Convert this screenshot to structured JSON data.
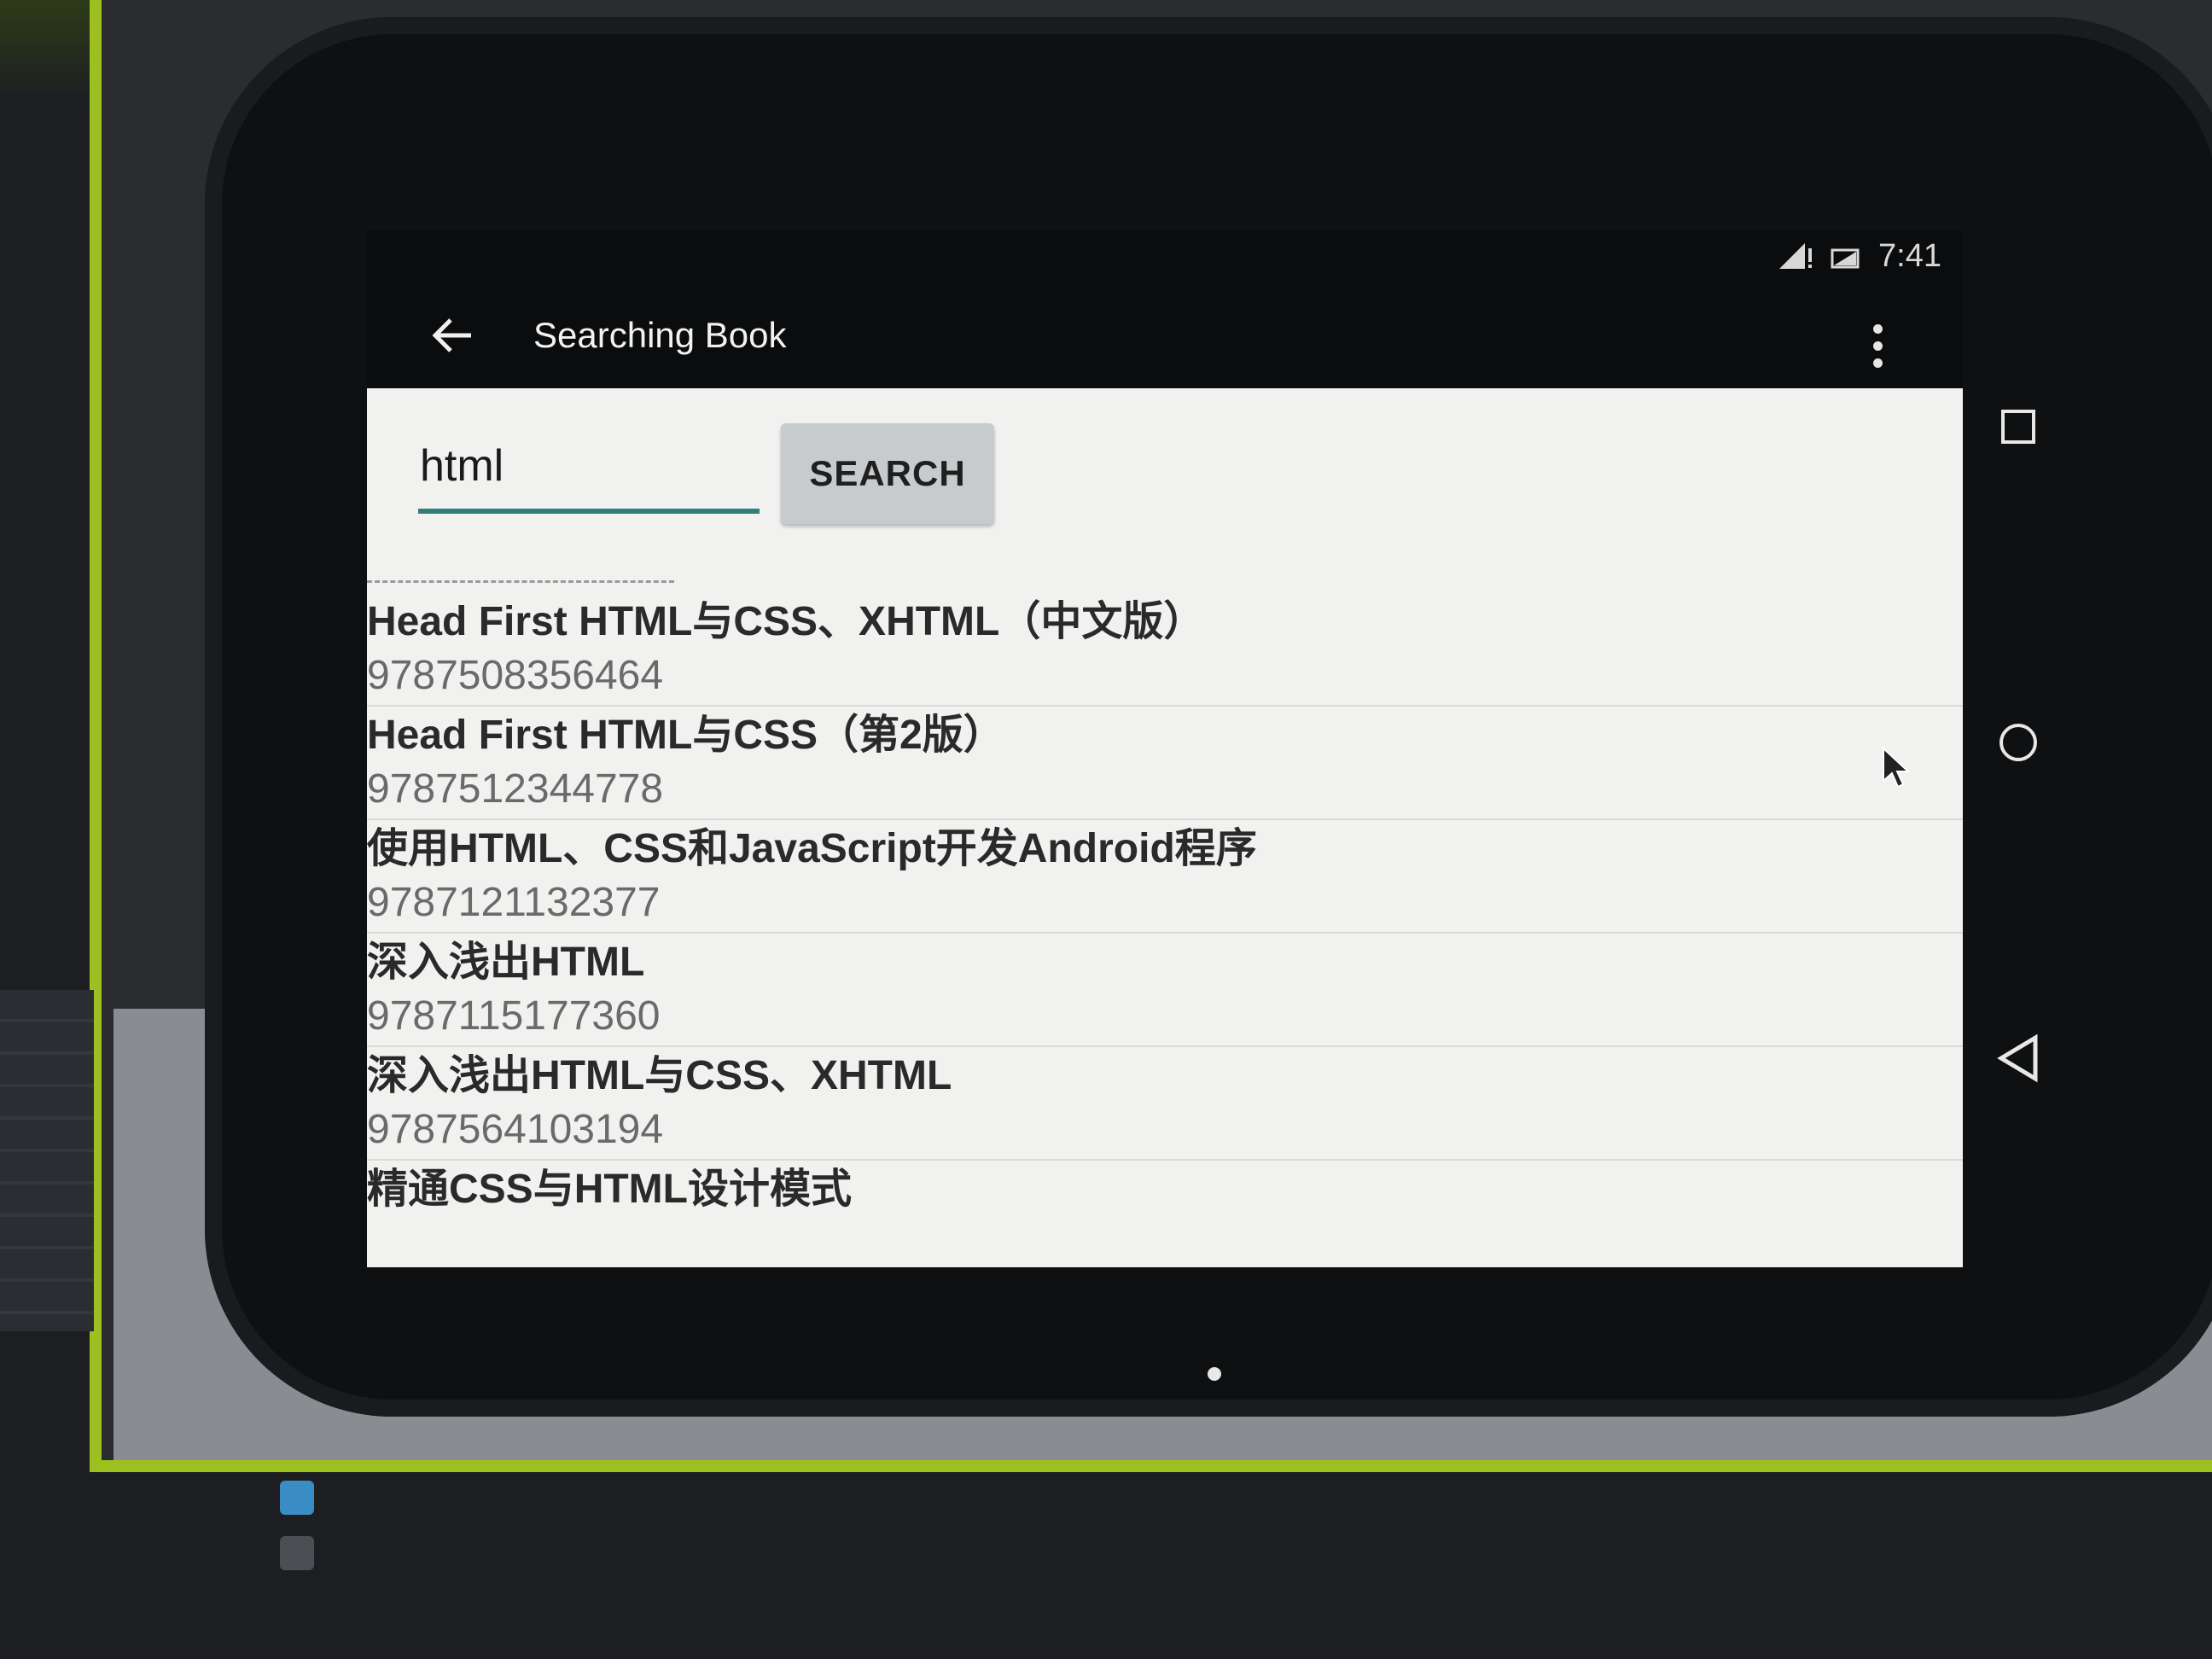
{
  "status_bar": {
    "time": "7:41"
  },
  "toolbar": {
    "title": "Searching Book"
  },
  "search": {
    "query": "html",
    "button_label": "SEARCH"
  },
  "books": [
    {
      "title": "Head First HTML与CSS、XHTML（中文版）",
      "isbn": "9787508356464"
    },
    {
      "title": "Head First HTML与CSS（第2版）",
      "isbn": "9787512344778"
    },
    {
      "title": "使用HTML、CSS和JavaScript开发Android程序",
      "isbn": "9787121132377"
    },
    {
      "title": "深入浅出HTML",
      "isbn": "9787115177360"
    },
    {
      "title": "深入浅出HTML与CSS、XHTML",
      "isbn": "9787564103194"
    },
    {
      "title": "精通CSS与HTML设计模式",
      "isbn": ""
    }
  ],
  "icons": {
    "back": "arrow-back-icon",
    "overflow": "more-vert-icon",
    "recents": "square-icon",
    "home": "circle-icon",
    "nav_back": "triangle-back-icon",
    "signal": "signal-icon",
    "battery": "battery-icon"
  },
  "colors": {
    "accent_underline": "#2f7f7a",
    "frame": "#9cc11e",
    "list_background": "#f1f2f0",
    "button_background": "#c8cbcd"
  }
}
